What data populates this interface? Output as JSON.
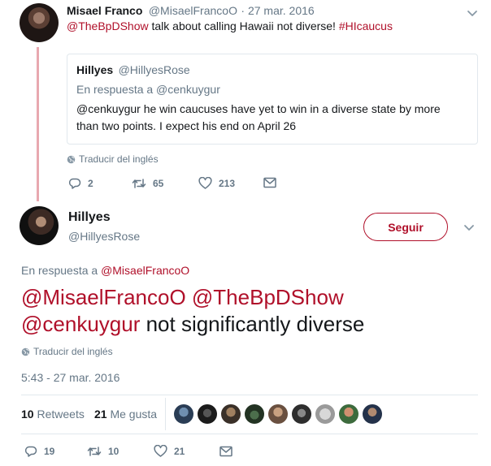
{
  "first_tweet": {
    "author_name": "Misael Franco",
    "author_handle": "@MisaelFrancoO",
    "separator_date": "· 27 mar. 2016",
    "text_mention": "@TheBpDShow",
    "text_body": " talk about calling Hawaii not diverse! ",
    "text_hashtag": "#HIcaucus",
    "quote": {
      "author_name": "Hillyes",
      "author_handle": "@HillyesRose",
      "reply_context": "En respuesta a @cenkuygur",
      "text_line1": "@cenkuygur he win caucuses have yet to win in a diverse state by more",
      "text_line2": "than two points. I expect his end on April 26"
    },
    "translate_label": "Traducir del inglés",
    "actions": {
      "replies": "2",
      "retweets": "65",
      "likes": "213"
    }
  },
  "main_tweet": {
    "author_name": "Hillyes",
    "author_handle": "@HillyesRose",
    "follow_label": "Seguir",
    "reply_prefix": "En respuesta a ",
    "reply_mention": "@MisaelFrancoO",
    "text_mention1": "@MisaelFrancoO",
    "text_mention2": "@TheBpDShow",
    "text_mention3": "@cenkuygur",
    "text_body": " not significantly diverse",
    "translate_label": "Traducir del inglés",
    "timestamp": "5:43 - 27 mar. 2016",
    "stats": {
      "retweets_count": "10",
      "retweets_label": "Retweets",
      "likes_count": "21",
      "likes_label": "Me gusta"
    },
    "actions": {
      "replies": "19",
      "retweets": "10",
      "likes": "21"
    }
  },
  "colors": {
    "accent": "#b0102a",
    "muted": "#657786",
    "thread_line": "#e8a8b0",
    "border": "#e1e8ed"
  }
}
